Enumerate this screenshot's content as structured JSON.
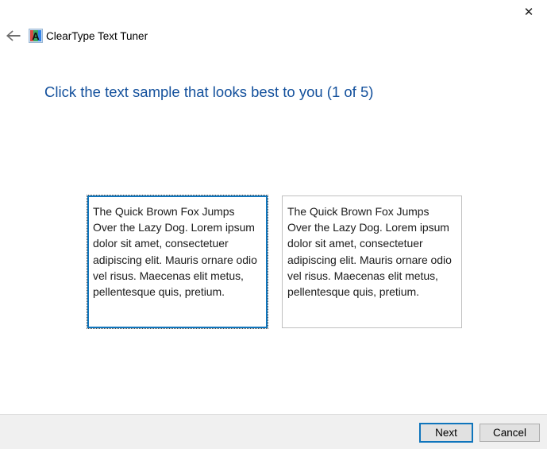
{
  "window": {
    "title": "ClearType Text Tuner",
    "close_label": "✕",
    "back_label": "←",
    "icon_letter": "A"
  },
  "heading": {
    "text": "Click the text sample that looks best to you (1 of 5)",
    "color": "#13509c"
  },
  "samples": [
    {
      "id": "sample-1",
      "selected": true,
      "text": "The Quick Brown Fox Jumps Over the Lazy Dog. Lorem ipsum dolor sit amet, consectetuer adipiscing elit. Mauris ornare odio vel risus. Maecenas elit metus, pellentesque quis, pretium."
    },
    {
      "id": "sample-2",
      "selected": false,
      "text": "The Quick Brown Fox Jumps Over the Lazy Dog. Lorem ipsum dolor sit amet, consectetuer adipiscing elit. Mauris ornare odio vel risus. Maecenas elit metus, pellentesque quis, pretium."
    }
  ],
  "footer": {
    "next_label": "Next",
    "cancel_label": "Cancel",
    "accent_color": "#0f75bc",
    "background": "#f0f0f0"
  }
}
